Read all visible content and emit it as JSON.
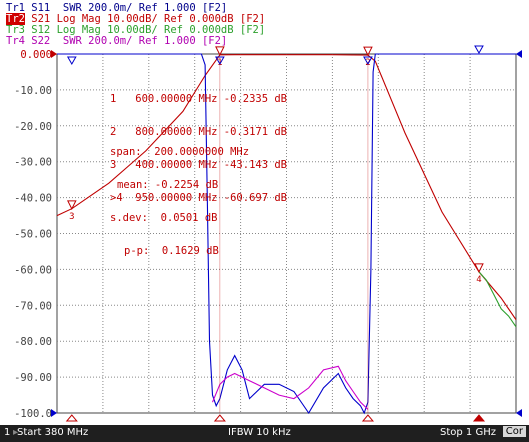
{
  "legend": [
    {
      "id": "Tr1",
      "text": " S11  SWR 200.0m/ Ref 1.000 [F2]",
      "color": "#00008b",
      "active": false
    },
    {
      "id": "Tr2",
      "text": " S21 Log Mag 10.00dB/ Ref 0.000dB [F2]",
      "color": "#c00000",
      "active": true
    },
    {
      "id": "Tr3",
      "text": " S12 Log Mag 10.00dB/ Ref 0.000dB [F2]",
      "color": "#2ca02c",
      "active": false
    },
    {
      "id": "Tr4",
      "text": " S22  SWR 200.0m/ Ref 1.000 [F2]",
      "color": "#b000b0",
      "active": false
    }
  ],
  "y_ticks": [
    "0.000",
    "-10.00",
    "-20.00",
    "-30.00",
    "-40.00",
    "-50.00",
    "-60.00",
    "-70.00",
    "-80.00",
    "-90.00",
    "-100.0"
  ],
  "marker_table": [
    "1   600.00000 MHz -0.2335 dB",
    "2   800.00000 MHz -0.3171 dB",
    "3   400.00000 MHz -43.143 dB",
    ">4  950.00000 MHz -60.697 dB"
  ],
  "stats": [
    "span:  200.0000000 MHz",
    "mean: -0.2254 dB",
    "s.dev:  0.0501 dB",
    "p-p:  0.1629 dB"
  ],
  "markers": [
    {
      "label": "1",
      "x_mhz": 600,
      "y_db": -0.2335
    },
    {
      "label": "2",
      "x_mhz": 800,
      "y_db": -0.3171
    },
    {
      "label": "3",
      "x_mhz": 400,
      "y_db": -43.143
    },
    {
      "label": "4",
      "x_mhz": 950,
      "y_db": -60.697
    }
  ],
  "status": {
    "channel": "1",
    "start": "Start 380 MHz",
    "ifbw": "IFBW 10 kHz",
    "stop": "Stop 1 GHz",
    "cor": "Cor"
  },
  "chart_data": {
    "type": "line",
    "x_range_mhz": [
      380,
      1000
    ],
    "ylim": [
      -100,
      0
    ],
    "ylabel_unit": "dB",
    "grid": true,
    "series": [
      {
        "name": "S21",
        "color": "#c00000",
        "x": [
          380,
          400,
          450,
          500,
          550,
          580,
          600,
          620,
          650,
          700,
          750,
          780,
          800,
          810,
          850,
          900,
          950,
          980,
          1000
        ],
        "y": [
          -45,
          -43.1,
          -36,
          -27,
          -16,
          -6,
          -0.23,
          -0.2,
          -0.2,
          -0.2,
          -0.2,
          -0.25,
          -0.32,
          -2,
          -22,
          -44,
          -60.7,
          -68,
          -74
        ]
      },
      {
        "name": "S12",
        "color": "#2ca02c",
        "x": [
          950,
          960,
          970,
          980,
          990,
          1000
        ],
        "y": [
          -60.7,
          -63,
          -67,
          -71,
          -73,
          -76
        ]
      },
      {
        "name": "S11",
        "color": "#0000cc",
        "x": [
          380,
          575,
          580,
          583,
          586,
          590,
          595,
          600,
          610,
          620,
          630,
          640,
          660,
          680,
          700,
          720,
          740,
          760,
          770,
          780,
          790,
          795,
          800,
          804,
          807,
          810,
          900,
          1000
        ],
        "y": [
          0,
          0,
          -3,
          -40,
          -80,
          -95,
          -98,
          -96,
          -88,
          -84,
          -88,
          -96,
          -92,
          -92,
          -94,
          -100,
          -93,
          -89,
          -93,
          -96,
          -98,
          -100,
          -97,
          -60,
          -5,
          0,
          0,
          0
        ]
      },
      {
        "name": "S22",
        "color": "#cc00cc",
        "x": [
          590,
          600,
          610,
          620,
          640,
          660,
          680,
          700,
          720,
          740,
          760,
          770,
          780,
          790,
          800
        ],
        "y": [
          -97,
          -92,
          -90,
          -89,
          -91,
          -93,
          -95,
          -96,
          -93,
          -88,
          -87,
          -91,
          -94,
          -97,
          -99
        ]
      }
    ]
  }
}
